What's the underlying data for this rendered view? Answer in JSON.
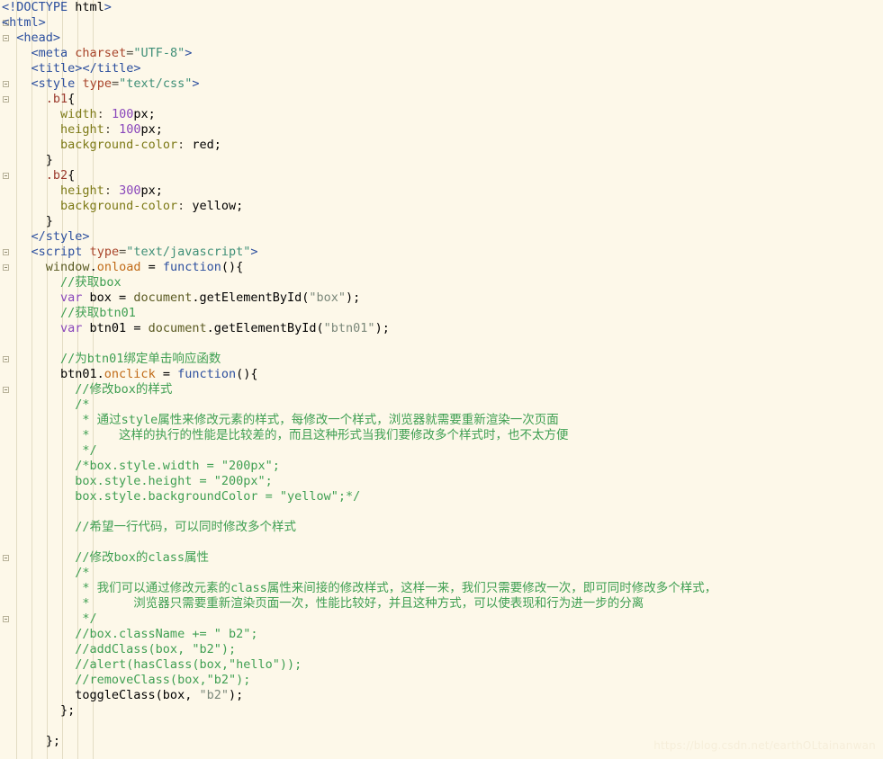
{
  "editor": {
    "background_color": "#fdf8e9",
    "guide_color": "#e3dcc4",
    "language": "html"
  },
  "watermark": {
    "text": "https://blog.csdn.net/earthOLtainanwan"
  },
  "colors": {
    "tag": "#2c4f9e",
    "attribute": "#a8442a",
    "attribute_value": "#3f8f77",
    "selector": "#9b3a2d",
    "css_property": "#7d7a17",
    "number": "#8a47bb",
    "keyword": "#8a47bb",
    "function": "#2c4f9e",
    "event": "#c06a17",
    "string": "#7a8779",
    "comment": "#3f9f52",
    "plain": "#141414"
  },
  "code": {
    "lines": [
      "<!DOCTYPE html>",
      "<html>",
      "  <head>",
      "    <meta charset=\"UTF-8\">",
      "    <title></title>",
      "    <style type=\"text/css\">",
      "      .b1{",
      "        width: 100px;",
      "        height: 100px;",
      "        background-color: red;",
      "      }",
      "      .b2{",
      "        height: 300px;",
      "        background-color: yellow;",
      "      }",
      "    </style>",
      "    <script type=\"text/javascript\">",
      "      window.onload = function(){",
      "        //获取box",
      "        var box = document.getElementById(\"box\");",
      "        //获取btn01",
      "        var btn01 = document.getElementById(\"btn01\");",
      "",
      "        //为btn01绑定单击响应函数",
      "        btn01.onclick = function(){",
      "          //修改box的样式",
      "          /*",
      "           * 通过style属性来修改元素的样式，每修改一个样式，浏览器就需要重新渲染一次页面",
      "           *    这样的执行的性能是比较差的，而且这种形式当我们要修改多个样式时，也不太方便",
      "           */",
      "          /*box.style.width = \"200px\";",
      "          box.style.height = \"200px\";",
      "          box.style.backgroundColor = \"yellow\";*/",
      "",
      "          //希望一行代码，可以同时修改多个样式",
      "",
      "          //修改box的class属性",
      "          /*",
      "           * 我们可以通过修改元素的class属性来间接的修改样式，这样一来，我们只需要修改一次，即可同时修改多个样式，",
      "           *      浏览器只需要重新渲染页面一次，性能比较好，并且这种方式，可以使表现和行为进一步的分离",
      "           */",
      "          //box.className += \" b2\";",
      "          //addClass(box, \"b2\");",
      "          //alert(hasClass(box,\"hello\"));",
      "          //removeClass(box,\"b2\");",
      "          toggleClass(box, \"b2\");",
      "        };",
      "",
      "      };"
    ],
    "fold_marker_lines": [
      1,
      2,
      5,
      6,
      11,
      16,
      17,
      23,
      25,
      36,
      40
    ]
  }
}
